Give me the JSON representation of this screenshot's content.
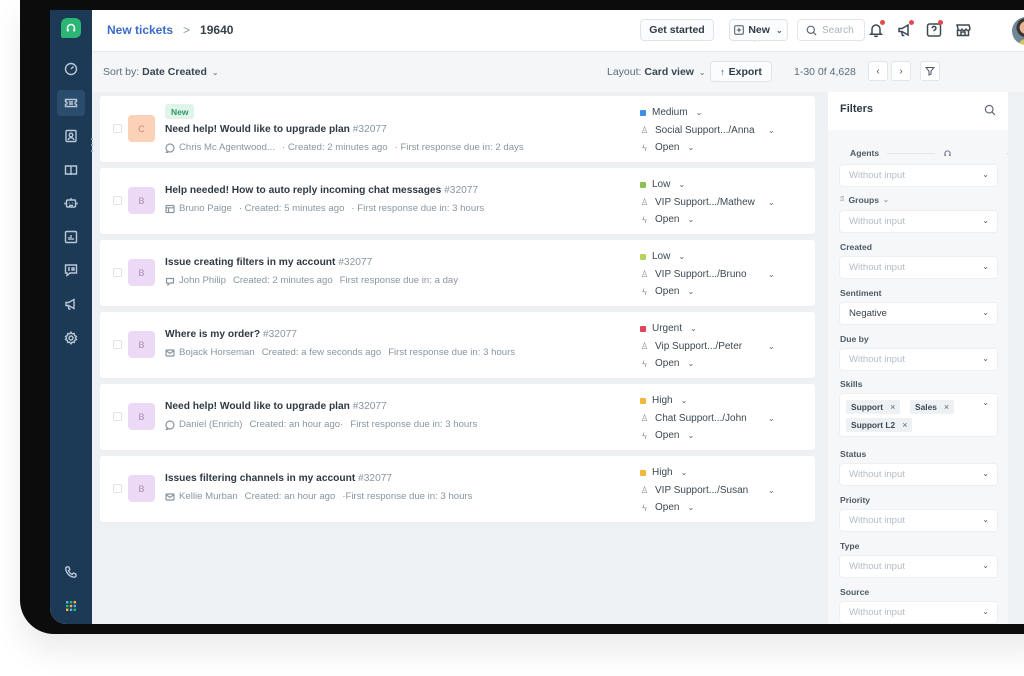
{
  "header": {
    "breadcrumb_parent": "New tickets",
    "breadcrumb_separator": ">",
    "breadcrumb_current": "19640",
    "get_started_label": "Get started",
    "new_label": "New",
    "search_placeholder": "Search",
    "notification_dot_color": "#e5484d"
  },
  "sidebar": {
    "items": [
      {
        "name": "dashboard",
        "icon": "gauge-icon"
      },
      {
        "name": "tickets",
        "icon": "ticket-icon",
        "active": true
      },
      {
        "name": "contacts",
        "icon": "contact-card-icon"
      },
      {
        "name": "knowledge-base",
        "icon": "book-icon"
      },
      {
        "name": "bots",
        "icon": "bot-icon"
      },
      {
        "name": "analytics",
        "icon": "bar-chart-icon"
      },
      {
        "name": "chat",
        "icon": "chat-icon"
      },
      {
        "name": "campaigns",
        "icon": "megaphone-icon"
      },
      {
        "name": "settings",
        "icon": "gear-icon"
      }
    ],
    "bottom_items": [
      {
        "name": "phone",
        "icon": "phone-icon"
      },
      {
        "name": "apps",
        "icon": "apps-grid-icon"
      }
    ],
    "brand_color": "#2bb673"
  },
  "toolbar": {
    "sort_prefix": "Sort by:",
    "sort_value": "Date Created",
    "layout_prefix": "Layout:",
    "layout_value": "Card view",
    "export_label": "Export",
    "pagination": "1-30 0f 4,628"
  },
  "tickets": [
    {
      "avatar_letter": "C",
      "avatar_color": "peach",
      "badge": "New",
      "title": "Need help! Would like to upgrade plan",
      "number": "#32077",
      "source_icon": "chat-bubble-icon",
      "requester": "Chris Mc Agentwood...",
      "created": "· Created: 2 minutes ago",
      "due": "· First response due in: 2 days",
      "priority": "Medium",
      "priority_color": "#3d8ee6",
      "group": "Social Support.../Anna",
      "status": "Open"
    },
    {
      "avatar_letter": "B",
      "avatar_color": "lilac",
      "badge": "",
      "title": "Help needed! How to auto reply incoming chat messages",
      "number": "#32077",
      "source_icon": "portal-icon",
      "requester": "Bruno Paige",
      "created": "· Created: 5 minutes ago",
      "due": "· First response due in: 3 hours",
      "priority": "Low",
      "priority_color": "#8cc152",
      "group": "VIP Support.../Mathew",
      "status": "Open"
    },
    {
      "avatar_letter": "B",
      "avatar_color": "lilac",
      "badge": "",
      "title": "Issue creating filters in my account",
      "number": "#32077",
      "source_icon": "social-icon",
      "requester": "John Philip",
      "created": "Created: 2 minutes ago",
      "due": "First response due in: a day",
      "priority": "Low",
      "priority_color": "#b5d35a",
      "group": "VIP Support.../Bruno",
      "status": "Open"
    },
    {
      "avatar_letter": "B",
      "avatar_color": "lilac",
      "badge": "",
      "title": "Where is my order?",
      "number": "#32077",
      "source_icon": "email-icon",
      "requester": "Bojack Horseman",
      "created": "Created: a few seconds ago",
      "due": "First response due in: 3 hours",
      "priority": "Urgent",
      "priority_color": "#e0435a",
      "group": "Vip Support.../Peter",
      "status": "Open"
    },
    {
      "avatar_letter": "B",
      "avatar_color": "lilac",
      "badge": "",
      "title": "Need help! Would like to upgrade plan",
      "number": "#32077",
      "source_icon": "chat-bubble-icon",
      "requester": "Daniel (Enrich)",
      "created": "Created: an hour ago·",
      "due": "First response due in: 3 hours",
      "priority": "High",
      "priority_color": "#f5b63c",
      "group": "Chat Support.../John",
      "status": "Open"
    },
    {
      "avatar_letter": "B",
      "avatar_color": "lilac",
      "badge": "",
      "title": "Issues filtering channels in my account",
      "number": "#32077",
      "source_icon": "email-icon",
      "requester": "Kellie Murban",
      "created": "Created: an hour ago",
      "due": "·First response due in: 3 hours",
      "priority": "High",
      "priority_color": "#f5b63c",
      "group": "VIP Support.../Susan",
      "status": "Open"
    }
  ],
  "filters": {
    "title": "Filters",
    "fields": [
      {
        "label": "Agents",
        "value": "Without input",
        "filled": false
      },
      {
        "label": "Groups",
        "value": "Without input",
        "filled": false
      },
      {
        "label": "Created",
        "value": "Without input",
        "filled": false
      },
      {
        "label": "Sentiment",
        "value": "Negative",
        "filled": true
      },
      {
        "label": "Due by",
        "value": "Without input",
        "filled": false
      },
      {
        "label": "Skills",
        "chips": [
          "Support",
          "Sales",
          "Support L2"
        ]
      },
      {
        "label": "Status",
        "value": "Without input",
        "filled": false
      },
      {
        "label": "Priority",
        "value": "Without input",
        "filled": false
      },
      {
        "label": "Type",
        "value": "Without input",
        "filled": false
      },
      {
        "label": "Source",
        "value": "Without input",
        "filled": false
      }
    ]
  }
}
